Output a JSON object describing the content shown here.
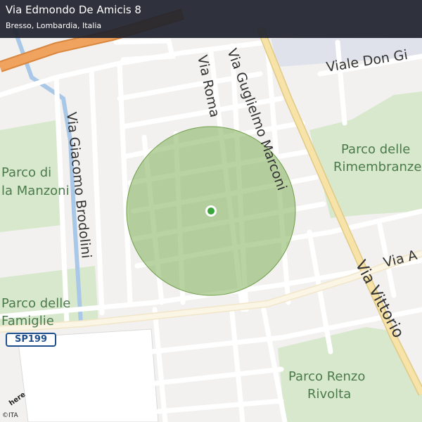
{
  "header": {
    "title": "Via Edmondo De Amicis 8",
    "subtitle": "Bresso, Lombardia, Italia"
  },
  "roads": {
    "via_roma": "Via Roma",
    "via_marconi": "Via Guglielmo Marconi",
    "via_brodolini": "Via Giacomo  Brodolini",
    "viale_don": "Viale  Don  Gi",
    "via_vittorio": "Via  Vittorio",
    "via_a": "Via  A"
  },
  "parks": {
    "manzoni_1": "Parco di",
    "manzoni_2": "la Manzoni",
    "rimembranze_1": "Parco delle",
    "rimembranze_2": "Rimembranze",
    "famiglie_1": "Parco delle",
    "famiglie_2": "Famiglie",
    "rivolta_1": "Parco Renzo",
    "rivolta_2": "Rivolta"
  },
  "shield": "SP199",
  "logo": "here",
  "credit": "©ITA",
  "colors": {
    "header_bg": "#1e222c",
    "land": "#f2f1ef",
    "park": "#d7e8cc",
    "road": "#ffffff",
    "major_road": "#f7e3a7",
    "highway": "#f0a35e",
    "water": "#a9c8e8",
    "accuracy_circle": "#7fae57",
    "location_dot": "#3aa63a"
  },
  "map_elements": {
    "location_marker": "current-location",
    "accuracy_area": "accuracy-circle"
  }
}
